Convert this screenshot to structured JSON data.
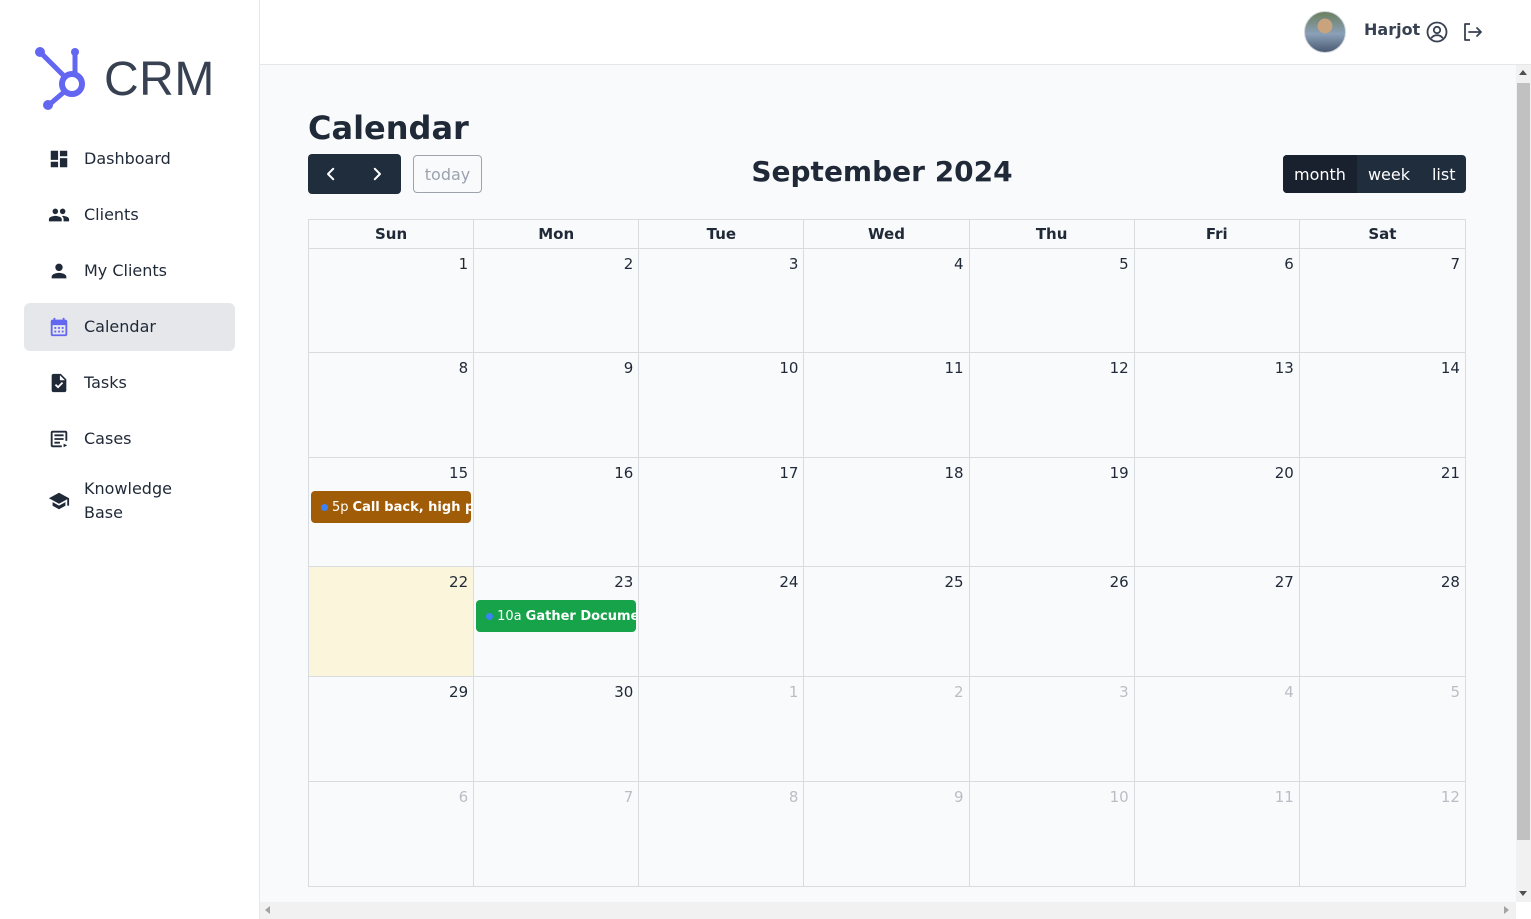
{
  "app": {
    "logo_text": "CRM"
  },
  "sidebar": {
    "items": [
      {
        "label": "Dashboard",
        "icon": "dashboard-icon",
        "active": false
      },
      {
        "label": "Clients",
        "icon": "clients-icon",
        "active": false
      },
      {
        "label": "My Clients",
        "icon": "person-icon",
        "active": false
      },
      {
        "label": "Calendar",
        "icon": "calendar-icon",
        "active": true
      },
      {
        "label": "Tasks",
        "icon": "task-icon",
        "active": false
      },
      {
        "label": "Cases",
        "icon": "cases-icon",
        "active": false
      },
      {
        "label": "Knowledge Base",
        "icon": "graduation-cap-icon",
        "active": false
      }
    ]
  },
  "topbar": {
    "username": "Harjot"
  },
  "page": {
    "title": "Calendar"
  },
  "toolbar": {
    "today_label": "today",
    "month_title": "September 2024",
    "views": [
      {
        "label": "month",
        "active": true
      },
      {
        "label": "week",
        "active": false
      },
      {
        "label": "list",
        "active": false
      }
    ]
  },
  "calendar": {
    "weekdays": [
      "Sun",
      "Mon",
      "Tue",
      "Wed",
      "Thu",
      "Fri",
      "Sat"
    ],
    "weeks": [
      {
        "days": [
          "1",
          "2",
          "3",
          "4",
          "5",
          "6",
          "7"
        ],
        "other": [
          false,
          false,
          false,
          false,
          false,
          false,
          false
        ]
      },
      {
        "days": [
          "8",
          "9",
          "10",
          "11",
          "12",
          "13",
          "14"
        ],
        "other": [
          false,
          false,
          false,
          false,
          false,
          false,
          false
        ]
      },
      {
        "days": [
          "15",
          "16",
          "17",
          "18",
          "19",
          "20",
          "21"
        ],
        "other": [
          false,
          false,
          false,
          false,
          false,
          false,
          false
        ]
      },
      {
        "days": [
          "22",
          "23",
          "24",
          "25",
          "26",
          "27",
          "28"
        ],
        "other": [
          false,
          false,
          false,
          false,
          false,
          false,
          false
        ]
      },
      {
        "days": [
          "29",
          "30",
          "1",
          "2",
          "3",
          "4",
          "5"
        ],
        "other": [
          false,
          false,
          true,
          true,
          true,
          true,
          true
        ]
      },
      {
        "days": [
          "6",
          "7",
          "8",
          "9",
          "10",
          "11",
          "12"
        ],
        "other": [
          true,
          true,
          true,
          true,
          true,
          true,
          true
        ]
      }
    ],
    "today": "22",
    "events": [
      {
        "day": "15",
        "time": "5p",
        "title": "Call back, high priority",
        "color": "#a15c07"
      },
      {
        "day": "23",
        "time": "10a",
        "title": "Gather Documents",
        "color": "#16a34a"
      }
    ]
  },
  "colors": {
    "accent": "#6366f1",
    "dark_button": "#1f2d3d",
    "today_bg": "#fbf5dc"
  }
}
